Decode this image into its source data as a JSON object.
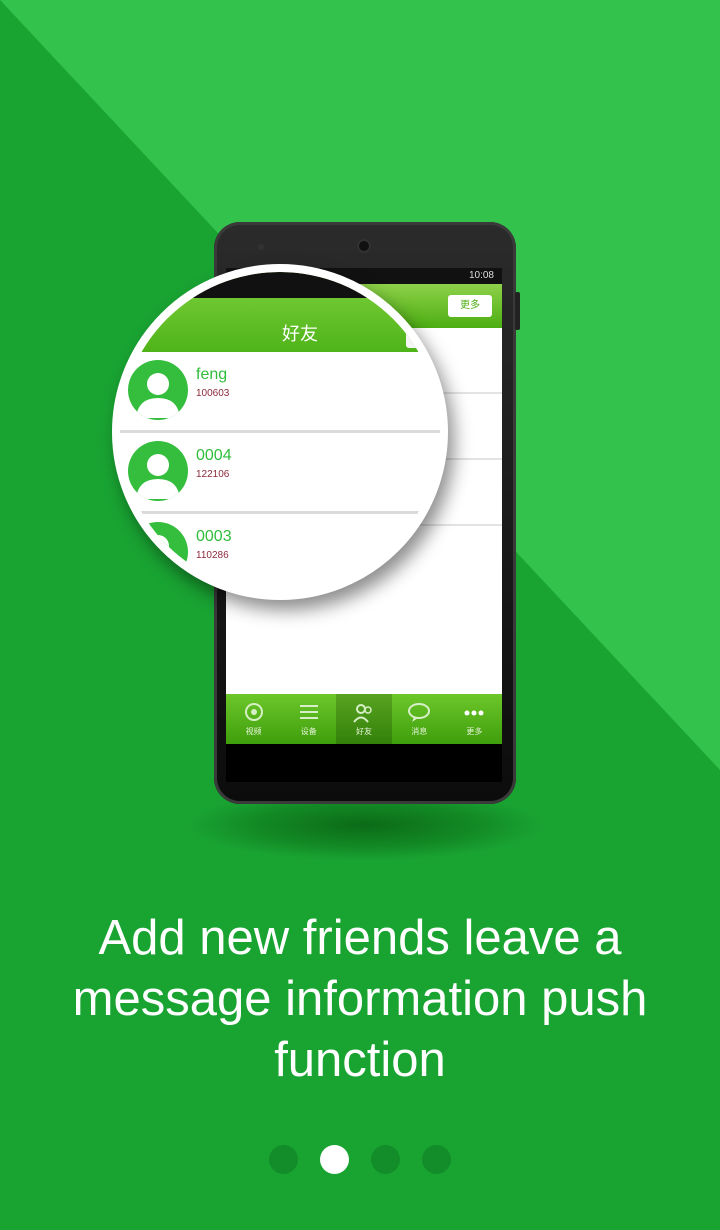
{
  "colors": {
    "background_dark": "#19a432",
    "background_light": "#33c24c",
    "app_green": "#4cae12",
    "contact_name": "#2fbd3a",
    "contact_id": "#8c2a3b"
  },
  "phone": {
    "status_time": "10:08",
    "header_button": "更多",
    "tabs": [
      {
        "label": "视频",
        "icon": "camera-icon"
      },
      {
        "label": "设备",
        "icon": "list-icon"
      },
      {
        "label": "好友",
        "icon": "friends-icon",
        "active": true
      },
      {
        "label": "消息",
        "icon": "message-icon"
      },
      {
        "label": "更多",
        "icon": "more-dots-icon"
      }
    ]
  },
  "magnifier": {
    "title": "好友",
    "contacts": [
      {
        "name": "feng",
        "id": "100603"
      },
      {
        "name": "0004",
        "id": "122106"
      },
      {
        "name": "0003",
        "id": "110286"
      }
    ]
  },
  "caption": {
    "line1": "Add new friends leave a",
    "line2": "message information push",
    "line3": "function"
  },
  "pager": {
    "total": 4,
    "active_index": 1
  }
}
